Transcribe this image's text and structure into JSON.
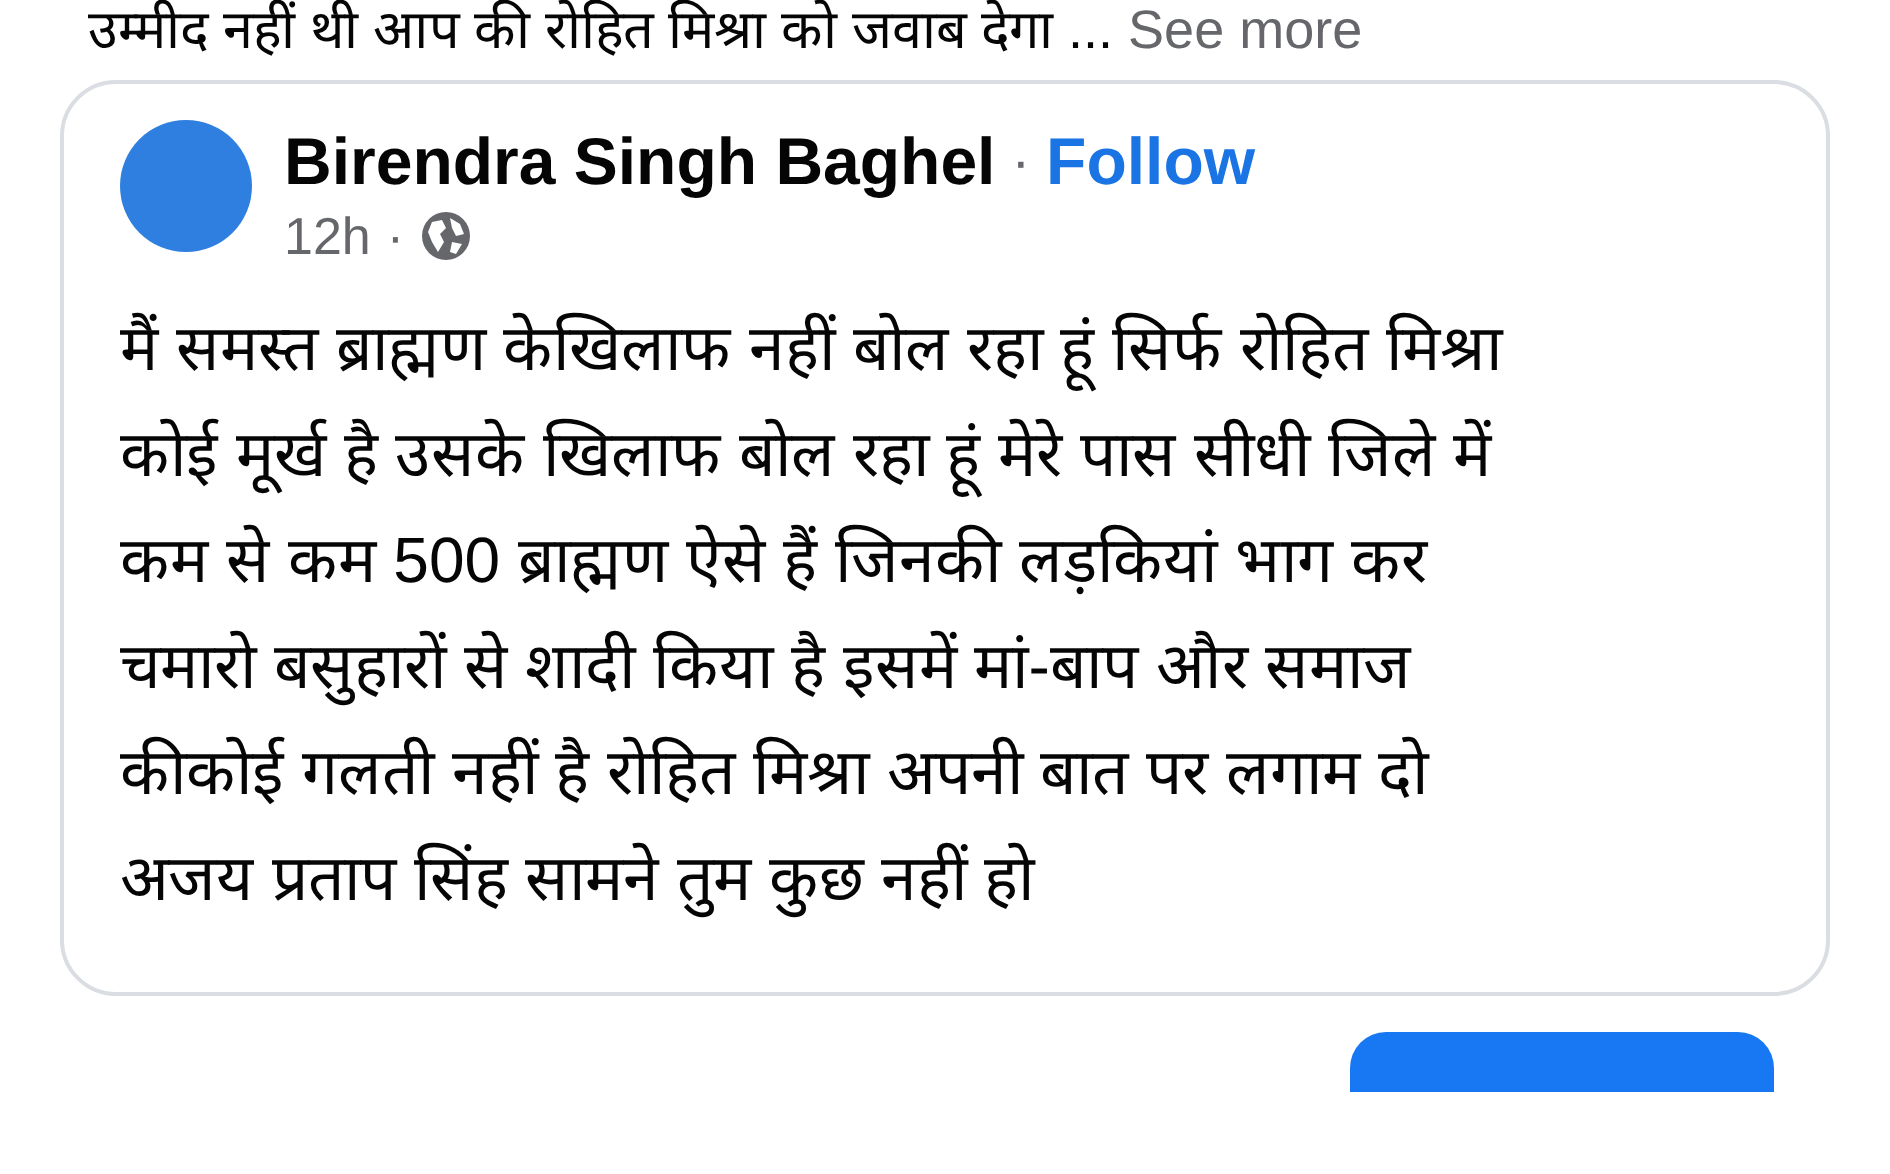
{
  "caption": {
    "text": "उम्मीद नहीं थी आप की रोहित मिश्रा को जवाब देगा ...",
    "see_more": "See more"
  },
  "shared_post": {
    "author": "Birendra Singh Baghel",
    "separator": "·",
    "follow": "Follow",
    "time": "12h",
    "time_separator": "·",
    "public": true,
    "body": "मैं समस्त ब्राह्मण केखिलाफ नहीं बोल रहा हूं सिर्फ रोहित मिश्रा\nकोई मूर्ख है उसके खिलाफ बोल रहा हूं मेरे पास सीधी जिले में\nकम से कम 500 ब्राह्मण ऐसे हैं जिनकी लड़कियां भाग कर\nचमारो बसुहारों से शादी किया है इसमें मां-बाप और समाज\nकीकोई गलती नहीं है रोहित मिश्रा अपनी बात पर लगाम दो\nअजय प्रताप सिंह सामने तुम कुछ नहीं हो"
  }
}
